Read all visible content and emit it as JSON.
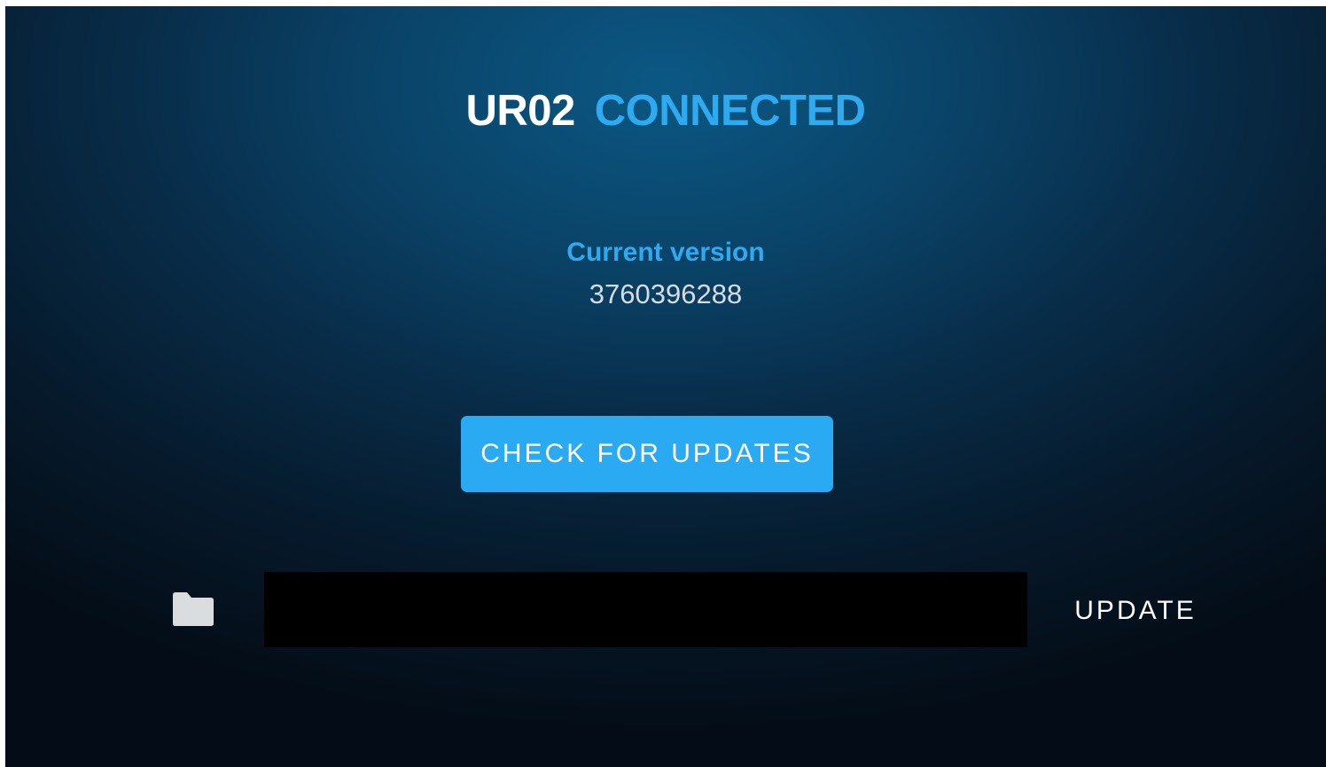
{
  "header": {
    "device_name": "UR02",
    "connection_status": "CONNECTED"
  },
  "version": {
    "label": "Current version",
    "value": "3760396288"
  },
  "actions": {
    "check_updates_label": "CHECK FOR UPDATES",
    "update_label": "UPDATE"
  },
  "file_picker": {
    "value": "",
    "icon": "folder-icon"
  },
  "colors": {
    "accent": "#2eaaf0",
    "button": "#2aaaf2",
    "background_center": "#0b5884",
    "background_edge": "#040d17",
    "field": "#000000"
  }
}
